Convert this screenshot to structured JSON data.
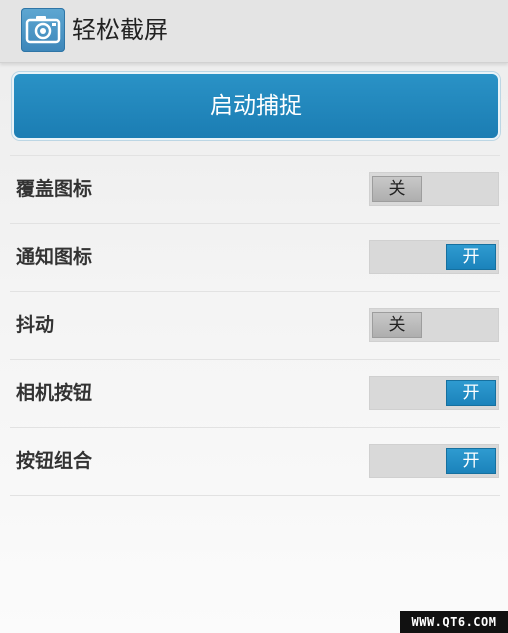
{
  "app": {
    "title": "轻松截屏",
    "icon": "camera-icon"
  },
  "capture_button": {
    "label": "启动捕捉"
  },
  "settings": [
    {
      "label": "覆盖图标",
      "state": "off",
      "toggle_text": "关"
    },
    {
      "label": "通知图标",
      "state": "on",
      "toggle_text": "开"
    },
    {
      "label": "抖动",
      "state": "off",
      "toggle_text": "关"
    },
    {
      "label": "相机按钮",
      "state": "on",
      "toggle_text": "开"
    },
    {
      "label": "按钮组合",
      "state": "on",
      "toggle_text": "开"
    }
  ],
  "colors": {
    "accent": "#1f86bd",
    "toggle_on": "#2290c8",
    "toggle_off": "#b8b8b8"
  },
  "watermark": {
    "text": "WWW.QT6.COM"
  }
}
